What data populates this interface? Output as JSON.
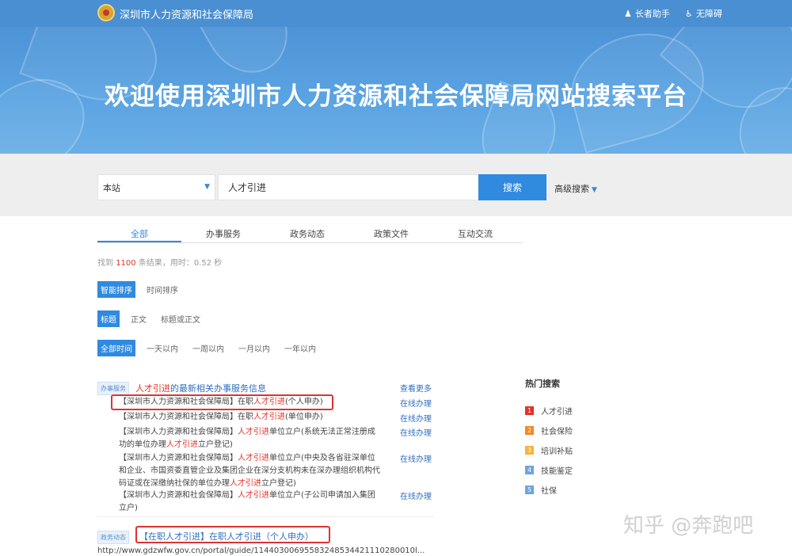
{
  "header": {
    "site_title": "深圳市人力资源和社会保障局",
    "tool_elder": "长者助手",
    "tool_access": "无障碍"
  },
  "hero": {
    "headline": "欢迎使用深圳市人力资源和社会保障局网站搜索平台"
  },
  "search": {
    "scope": "本站",
    "query": "人才引进",
    "button": "搜索",
    "advanced": "高级搜索"
  },
  "tabs": [
    "全部",
    "办事服务",
    "政务动态",
    "政策文件",
    "互动交流"
  ],
  "stats": {
    "prefix": "找到 ",
    "count": "1100",
    "suffix": " 条结果，用时：0.52 秒"
  },
  "filters": {
    "sort": [
      "智能排序",
      "时间排序"
    ],
    "field": [
      "标题",
      "正文",
      "标题或正文"
    ],
    "time": [
      "全部时间",
      "一天以内",
      "一周以内",
      "一月以内",
      "一年以内"
    ]
  },
  "service_group": {
    "tag": "办事服务",
    "title_hl": "人才引进",
    "title_rest": "的最新相关办事服务信息",
    "more": "查看更多",
    "online": "在线办理",
    "items": [
      {
        "pre": "【深圳市人力资源和社会保障局】在职",
        "hl": "人才引进",
        "post": "(个人申办)"
      },
      {
        "pre": "【深圳市人力资源和社会保障局】在职",
        "hl": "人才引进",
        "post": "(单位申办)"
      },
      {
        "pre": "【深圳市人力资源和社会保障局】",
        "hl": "人才引进",
        "post": "单位立户(系统无法正常注册成功的单位办理",
        "hl2": "人才引进",
        "post2": "立户登记)"
      },
      {
        "pre": "【深圳市人力资源和社会保障局】",
        "hl": "人才引进",
        "post": "单位立户(中央及各省驻深单位和企业、市国资委直管企业及集团企业在深分支机构未在深办理组织机构代码证或在深缴纳社保的单位办理",
        "hl2": "人才引进",
        "post2": "立户登记)"
      },
      {
        "pre": "【深圳市人力资源和社会保障局】",
        "hl": "人才引进",
        "post": "单位立户(子公司申请加入集团立户)"
      }
    ]
  },
  "hot": {
    "title": "热门搜索",
    "items": [
      "人才引进",
      "社会保险",
      "培训补贴",
      "技能鉴定",
      "社保"
    ],
    "colors": [
      "#e2332b",
      "#f08a24",
      "#f5b43c",
      "#6ea3dd",
      "#6ea3dd"
    ]
  },
  "second_result": {
    "tag": "政务动态",
    "title": "【在职人才引进】在职人才引进（个人申办）",
    "url": "http://www.gdzwfw.gov.cn/portal/guide/11440300695583248534421110280010l..."
  },
  "watermark": "知乎 @奔跑吧"
}
